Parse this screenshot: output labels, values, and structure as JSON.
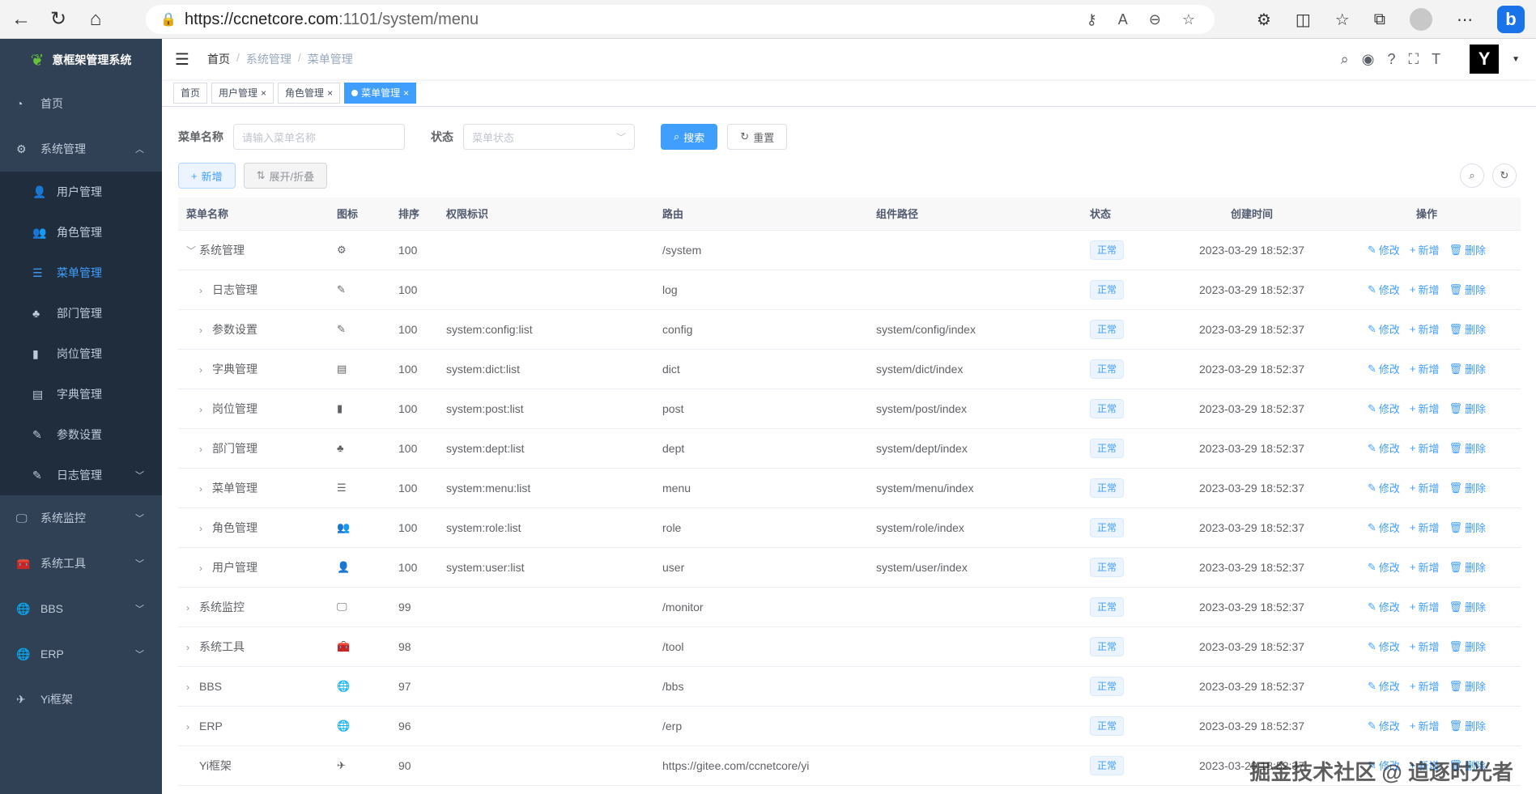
{
  "browser": {
    "url_host": "https://ccnetcore.com",
    "url_rest": ":1101/system/menu"
  },
  "sidebar": {
    "logo_text": "意框架管理系统",
    "items": [
      {
        "label": "首页",
        "icon": "dashboard-icon"
      },
      {
        "label": "系统管理",
        "icon": "gear-icon",
        "expanded": true
      },
      {
        "label": "系统监控",
        "icon": "monitor-icon"
      },
      {
        "label": "系统工具",
        "icon": "toolbox-icon"
      },
      {
        "label": "BBS",
        "icon": "globe-icon"
      },
      {
        "label": "ERP",
        "icon": "globe-icon"
      },
      {
        "label": "Yi框架",
        "icon": "paper-plane-icon"
      }
    ],
    "submenu": [
      {
        "label": "用户管理",
        "icon": "user-icon"
      },
      {
        "label": "角色管理",
        "icon": "peoples-icon"
      },
      {
        "label": "菜单管理",
        "icon": "tree-table-icon",
        "active": true
      },
      {
        "label": "部门管理",
        "icon": "tree-icon"
      },
      {
        "label": "岗位管理",
        "icon": "post-icon"
      },
      {
        "label": "字典管理",
        "icon": "dict-icon"
      },
      {
        "label": "参数设置",
        "icon": "edit-icon"
      },
      {
        "label": "日志管理",
        "icon": "log-icon"
      }
    ]
  },
  "navbar": {
    "breadcrumb": [
      "首页",
      "系统管理",
      "菜单管理"
    ]
  },
  "tags": [
    {
      "label": "首页",
      "closable": false,
      "active": false
    },
    {
      "label": "用户管理",
      "closable": true,
      "active": false
    },
    {
      "label": "角色管理",
      "closable": true,
      "active": false
    },
    {
      "label": "菜单管理",
      "closable": true,
      "active": true
    }
  ],
  "search": {
    "name_label": "菜单名称",
    "name_placeholder": "请输入菜单名称",
    "status_label": "状态",
    "status_placeholder": "菜单状态",
    "search_button": "搜索",
    "reset_button": "重置"
  },
  "toolbar": {
    "add_button": "新增",
    "expand_button": "展开/折叠"
  },
  "table": {
    "columns": [
      "菜单名称",
      "图标",
      "排序",
      "权限标识",
      "路由",
      "组件路径",
      "状态",
      "创建时间",
      "操作"
    ],
    "actions": {
      "edit": "修改",
      "add": "新增",
      "delete": "删除"
    },
    "rows": [
      {
        "name": "系统管理",
        "level": 0,
        "arrow": "﹀",
        "icon": "⚙",
        "order": "100",
        "perm": "",
        "route": "/system",
        "component": "",
        "status": "正常",
        "created": "2023-03-29 18:52:37"
      },
      {
        "name": "日志管理",
        "level": 1,
        "arrow": "›",
        "icon": "✎",
        "order": "100",
        "perm": "",
        "route": "log",
        "component": "",
        "status": "正常",
        "created": "2023-03-29 18:52:37"
      },
      {
        "name": "参数设置",
        "level": 1,
        "arrow": "›",
        "icon": "✎",
        "order": "100",
        "perm": "system:config:list",
        "route": "config",
        "component": "system/config/index",
        "status": "正常",
        "created": "2023-03-29 18:52:37"
      },
      {
        "name": "字典管理",
        "level": 1,
        "arrow": "›",
        "icon": "▤",
        "order": "100",
        "perm": "system:dict:list",
        "route": "dict",
        "component": "system/dict/index",
        "status": "正常",
        "created": "2023-03-29 18:52:37"
      },
      {
        "name": "岗位管理",
        "level": 1,
        "arrow": "›",
        "icon": "▮",
        "order": "100",
        "perm": "system:post:list",
        "route": "post",
        "component": "system/post/index",
        "status": "正常",
        "created": "2023-03-29 18:52:37"
      },
      {
        "name": "部门管理",
        "level": 1,
        "arrow": "›",
        "icon": "♣",
        "order": "100",
        "perm": "system:dept:list",
        "route": "dept",
        "component": "system/dept/index",
        "status": "正常",
        "created": "2023-03-29 18:52:37"
      },
      {
        "name": "菜单管理",
        "level": 1,
        "arrow": "›",
        "icon": "☰",
        "order": "100",
        "perm": "system:menu:list",
        "route": "menu",
        "component": "system/menu/index",
        "status": "正常",
        "created": "2023-03-29 18:52:37"
      },
      {
        "name": "角色管理",
        "level": 1,
        "arrow": "›",
        "icon": "👥",
        "order": "100",
        "perm": "system:role:list",
        "route": "role",
        "component": "system/role/index",
        "status": "正常",
        "created": "2023-03-29 18:52:37"
      },
      {
        "name": "用户管理",
        "level": 1,
        "arrow": "›",
        "icon": "👤",
        "order": "100",
        "perm": "system:user:list",
        "route": "user",
        "component": "system/user/index",
        "status": "正常",
        "created": "2023-03-29 18:52:37"
      },
      {
        "name": "系统监控",
        "level": 0,
        "arrow": "›",
        "icon": "🖵",
        "order": "99",
        "perm": "",
        "route": "/monitor",
        "component": "",
        "status": "正常",
        "created": "2023-03-29 18:52:37"
      },
      {
        "name": "系统工具",
        "level": 0,
        "arrow": "›",
        "icon": "🧰",
        "order": "98",
        "perm": "",
        "route": "/tool",
        "component": "",
        "status": "正常",
        "created": "2023-03-29 18:52:37"
      },
      {
        "name": "BBS",
        "level": 0,
        "arrow": "›",
        "icon": "🌐",
        "order": "97",
        "perm": "",
        "route": "/bbs",
        "component": "",
        "status": "正常",
        "created": "2023-03-29 18:52:37"
      },
      {
        "name": "ERP",
        "level": 0,
        "arrow": "›",
        "icon": "🌐",
        "order": "96",
        "perm": "",
        "route": "/erp",
        "component": "",
        "status": "正常",
        "created": "2023-03-29 18:52:37"
      },
      {
        "name": "Yi框架",
        "level": 0,
        "arrow": "",
        "icon": "✈",
        "order": "90",
        "perm": "",
        "route": "https://gitee.com/ccnetcore/yi",
        "component": "",
        "status": "正常",
        "created": "2023-03-29 18:52:37"
      }
    ]
  },
  "watermark": "掘金技术社区 @ 追逐时光者",
  "colors": {
    "sidebar_bg": "#304156",
    "submenu_bg": "#1f2d3d",
    "accent": "#409eff"
  }
}
